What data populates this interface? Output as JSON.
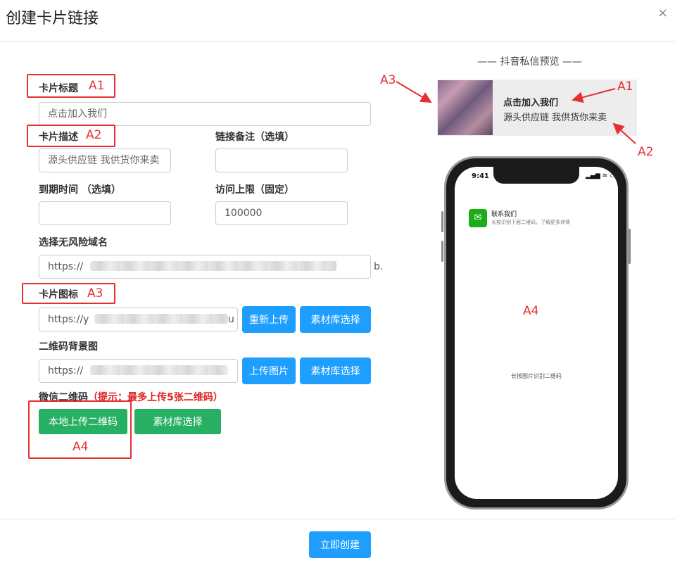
{
  "dialog": {
    "title": "创建卡片链接",
    "close_icon": "×"
  },
  "form": {
    "card_title": {
      "label": "卡片标题",
      "placeholder": "点击加入我们"
    },
    "card_desc": {
      "label": "卡片描述",
      "placeholder": "源头供应链 我供货你来卖"
    },
    "link_note": {
      "label": "链接备注（选填）",
      "value": ""
    },
    "expire_time": {
      "label": "到期时间 （选填）",
      "value": ""
    },
    "visit_limit": {
      "label": "访问上限（固定）",
      "value": "100000"
    },
    "domain": {
      "label": "选择无风险域名",
      "value_start": "https://",
      "value_end": "b."
    },
    "card_icon": {
      "label": "卡片图标",
      "value_start": "https://y",
      "value_end": "u",
      "reupload_label": "重新上传",
      "library_label": "素材库选择"
    },
    "qr_bg": {
      "label": "二维码背景图",
      "value_start": "https://",
      "upload_label": "上传图片",
      "library_label": "素材库选择"
    },
    "wechat_qr": {
      "label": "微信二维码",
      "hint": "（提示：最多上传5张二维码）",
      "local_upload_label": "本地上传二维码",
      "library_label": "素材库选择"
    }
  },
  "preview": {
    "title": "—— 抖音私信预览 ——",
    "card_title": "点击加入我们",
    "card_desc": "源头供应链 我供货你来卖",
    "phone": {
      "time": "9:41",
      "status": "▂▄▆ ≋ ▭",
      "contact_name": "联系我们",
      "contact_sub": "长按识别下面二维码，了解更多详情",
      "qr_hint": "长按图片识别二维码"
    }
  },
  "annotations": {
    "a1_left": "A1",
    "a2_left": "A2",
    "a3_left": "A3",
    "a4_left": "A4",
    "a1_right": "A1",
    "a2_right": "A2",
    "a3_right": "A3",
    "a4_phone": "A4"
  },
  "footer": {
    "submit_label": "立即创建"
  },
  "colors": {
    "primary": "#1e9fff",
    "success": "#27b063",
    "annotation": "#e53030"
  }
}
